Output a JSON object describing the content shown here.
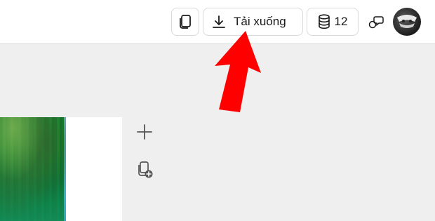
{
  "toolbar": {
    "download_label": "Tải xuống",
    "credits_count": "12"
  },
  "icons": {
    "copy": "copy-pages-icon",
    "download": "download-icon",
    "credits": "coins-stack-icon",
    "chat": "chat-bubbles-icon",
    "avatar": "user-avatar",
    "add_page": "plus-icon",
    "duplicate_page": "duplicate-page-icon"
  },
  "colors": {
    "annotation_arrow": "#ff0000",
    "toolbar_bg": "#ffffff",
    "canvas_bg": "#efefef",
    "border": "#d9d9d9"
  }
}
